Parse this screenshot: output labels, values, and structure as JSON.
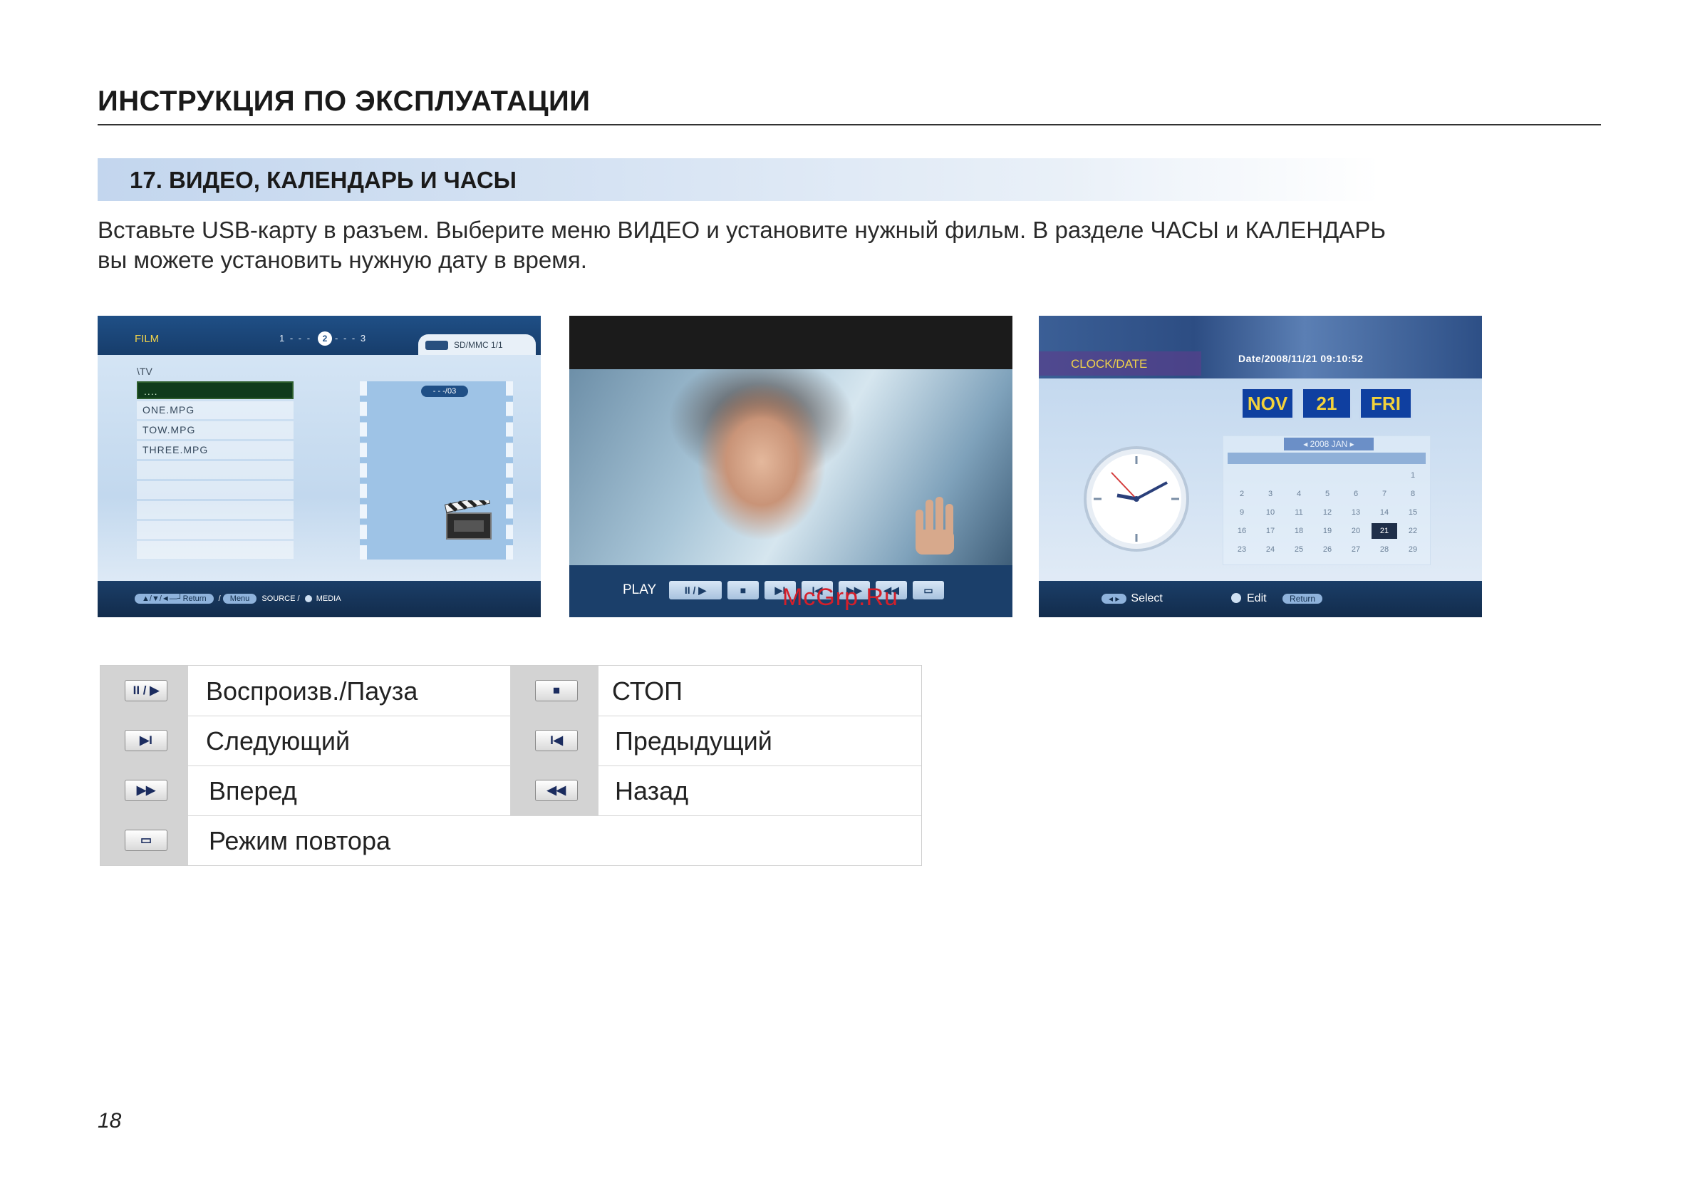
{
  "header": {
    "title": "ИНСТРУКЦИЯ ПО ЭКСПЛУАТАЦИИ"
  },
  "section": {
    "title": "17. ВИДЕО, КАЛЕНДАРЬ И ЧАСЫ",
    "intro_line1": "Вставьте USB-карту в разъем. Выберите меню ВИДЕО и установите нужный фильм. В разделе ЧАСЫ и КАЛЕНДАРЬ",
    "intro_line2": "вы можете установить нужную дату в время."
  },
  "screens": {
    "film": {
      "label": "FILM",
      "pager_left": "1 - - -",
      "pager_current": "2",
      "pager_right": "- - - 3",
      "source": "SD/MMC  1/1",
      "path": "\\TV",
      "files": [
        "....",
        "ONE.MPG",
        "TOW.MPG",
        "THREE.MPG",
        "",
        "",
        "",
        "",
        ""
      ],
      "count": "- - -/03",
      "help_nav": "▲/▼/◄—┘Return",
      "help_menu": "Menu",
      "help_source": "SOURCE /",
      "help_media": "MEDIA"
    },
    "video": {
      "play_label": "PLAY",
      "buttons": [
        "II / ▶",
        "■",
        "▶I",
        "I◀",
        "▶▶",
        "◀◀",
        "▭"
      ]
    },
    "clock": {
      "label": "CLOCK/DATE",
      "datetime": "Date/2008/11/21     09:10:52",
      "month": "NOV",
      "day": "21",
      "weekday": "FRI",
      "calendar_header": "◂   2008   JAN   ▸",
      "calendar_days": [
        "",
        "",
        "",
        "",
        "",
        "",
        "1",
        "2",
        "3",
        "4",
        "5",
        "6",
        "7",
        "8",
        "9",
        "10",
        "11",
        "12",
        "13",
        "14",
        "15",
        "16",
        "17",
        "18",
        "19",
        "20",
        "21",
        "22",
        "23",
        "24",
        "25",
        "26",
        "27",
        "28",
        "29"
      ],
      "calendar_selected": "21",
      "help_select": "Select",
      "help_edit": "Edit",
      "help_return": "Return"
    }
  },
  "watermark": "McGrp.Ru",
  "legend": [
    {
      "icon": "II / ▶",
      "icon_name": "play-pause-icon",
      "label": "Воспроизв./Пауза"
    },
    {
      "icon": "■",
      "icon_name": "stop-icon",
      "label": "СТОП"
    },
    {
      "icon": "▶I",
      "icon_name": "next-icon",
      "label": "Следующий"
    },
    {
      "icon": "I◀",
      "icon_name": "previous-icon",
      "label": "Предыдущий"
    },
    {
      "icon": "▶▶",
      "icon_name": "fast-forward-icon",
      "label": "Вперед"
    },
    {
      "icon": "◀◀",
      "icon_name": "rewind-icon",
      "label": "Назад"
    },
    {
      "icon": "▭",
      "icon_name": "repeat-icon",
      "label": "Режим повтора"
    }
  ],
  "page_number": "18"
}
